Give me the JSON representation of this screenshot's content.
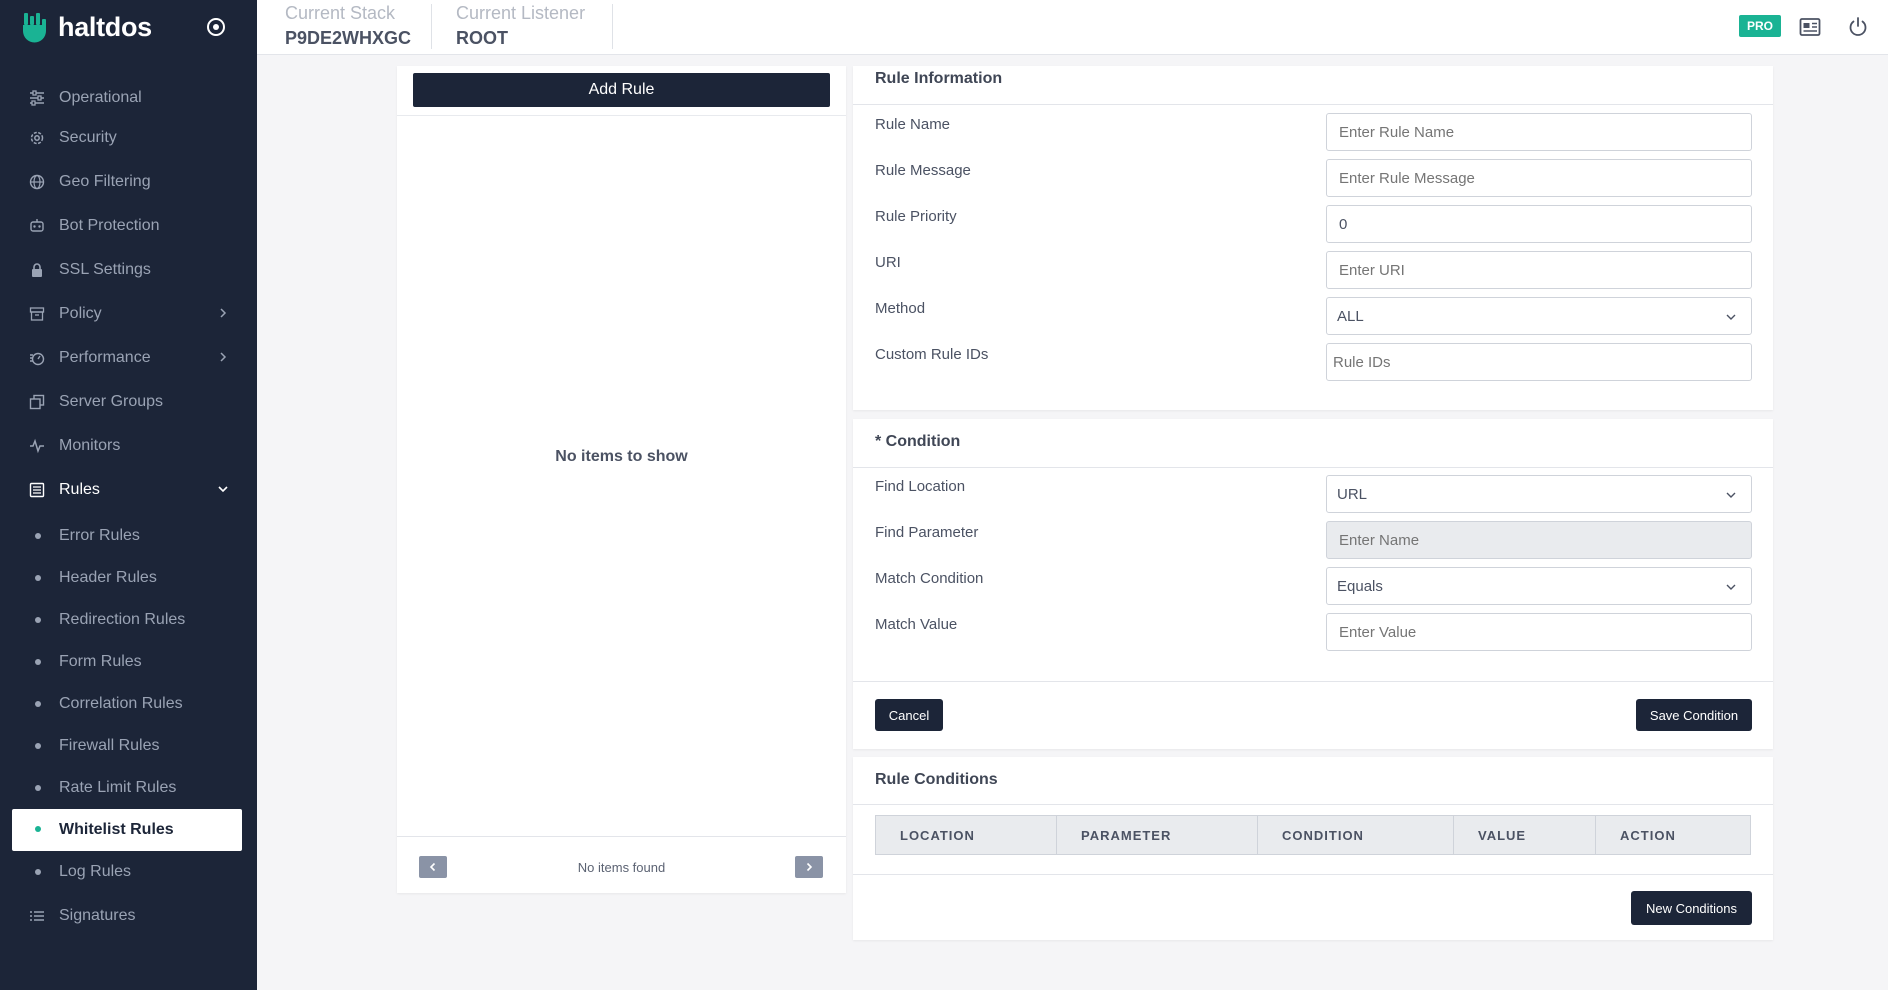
{
  "brand": {
    "name": "haltdos"
  },
  "header": {
    "stack_label": "Current Stack",
    "stack_value": "P9DE2WHXGC",
    "listener_label": "Current Listener",
    "listener_value": "ROOT",
    "badge": "PRO"
  },
  "sidebar": {
    "items": [
      {
        "label": "Operational",
        "icon": "sliders-icon"
      },
      {
        "label": "Security",
        "icon": "gear-icon"
      },
      {
        "label": "Geo Filtering",
        "icon": "globe-icon"
      },
      {
        "label": "Bot Protection",
        "icon": "bot-icon"
      },
      {
        "label": "SSL Settings",
        "icon": "lock-icon"
      },
      {
        "label": "Policy",
        "icon": "archive-icon"
      },
      {
        "label": "Performance",
        "icon": "speed-icon"
      },
      {
        "label": "Server Groups",
        "icon": "copy-icon"
      },
      {
        "label": "Monitors",
        "icon": "pulse-icon"
      },
      {
        "label": "Rules",
        "icon": "list-icon"
      }
    ],
    "sub_items": [
      {
        "label": "Error Rules"
      },
      {
        "label": "Header Rules"
      },
      {
        "label": "Redirection Rules"
      },
      {
        "label": "Form Rules"
      },
      {
        "label": "Correlation Rules"
      },
      {
        "label": "Firewall Rules"
      },
      {
        "label": "Rate Limit Rules"
      },
      {
        "label": "Whitelist Rules"
      },
      {
        "label": "Log Rules"
      }
    ],
    "signatures": "Signatures"
  },
  "list_panel": {
    "add_button": "Add Rule",
    "empty_text": "No items to show",
    "footer_text": "No items found"
  },
  "rule_info": {
    "title": "Rule Information",
    "rule_name_label": "Rule Name",
    "rule_name_placeholder": "Enter Rule Name",
    "rule_message_label": "Rule Message",
    "rule_message_placeholder": "Enter Rule Message",
    "rule_priority_label": "Rule Priority",
    "rule_priority_value": "0",
    "uri_label": "URI",
    "uri_placeholder": "Enter URI",
    "method_label": "Method",
    "method_value": "ALL",
    "custom_ids_label": "Custom Rule IDs",
    "custom_ids_placeholder": "Rule IDs"
  },
  "condition": {
    "title": "* Condition",
    "find_location_label": "Find Location",
    "find_location_value": "URL",
    "find_parameter_label": "Find Parameter",
    "find_parameter_placeholder": "Enter Name",
    "match_condition_label": "Match Condition",
    "match_condition_value": "Equals",
    "match_value_label": "Match Value",
    "match_value_placeholder": "Enter Value",
    "cancel": "Cancel",
    "save": "Save Condition"
  },
  "rule_conditions": {
    "title": "Rule Conditions",
    "columns": [
      "LOCATION",
      "PARAMETER",
      "CONDITION",
      "VALUE",
      "ACTION"
    ],
    "new_button": "New Conditions"
  },
  "colors": {
    "sidebar_bg": "#1c2538",
    "accent": "#1ab394"
  }
}
